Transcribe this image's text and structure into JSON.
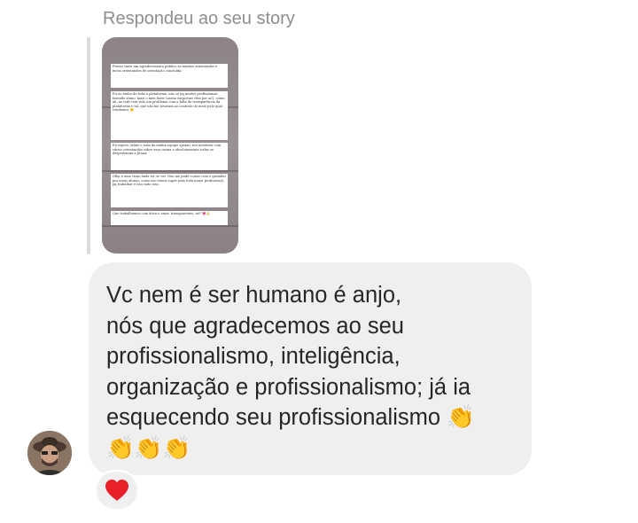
{
  "reply_label": "Respondeu ao seu story",
  "story": {
    "notes": [
      "Prezos fazer um agradecimento público às minhas orientandas e meus orientandos de orientação concluída.",
      "Eu ao tenho de toda a plataforma, não só pq muitos profissionais fazendo aluno, mais o meu fazer (assim surpresas vêm por aí!), como, ah, ao todo tem sido um problema com a falta de transparência da plataforma e tal, que não me levavam ao controle do meio pelo qual vendemos 🙂",
      "Eu espero (Aline e toda da minha equipe apoiar) seu mentoria com vários orientandos sobre essa turma e absolutamente todas se despertaram a Júnior.",
      "Olha é uma visão linda ter se ver. Não me pude contar com e gratidão pra meus alunos, como me vemos super pela toda nossa profissional, pq trabalhar é isso tudo isso.",
      "Que trabalhemos com ética e amor, transparentes, né? 💗🙏"
    ]
  },
  "message": {
    "text": "Vc nem é ser humano é anjo,\nnós que agradecemos ao seu\nprofissionalismo, inteligência,\norganização e profissionalismo; já ia\nesquecendo seu profissionalismo 👏\n👏👏👏"
  },
  "reaction": {
    "emoji": "heart",
    "color": "#e8202a"
  }
}
